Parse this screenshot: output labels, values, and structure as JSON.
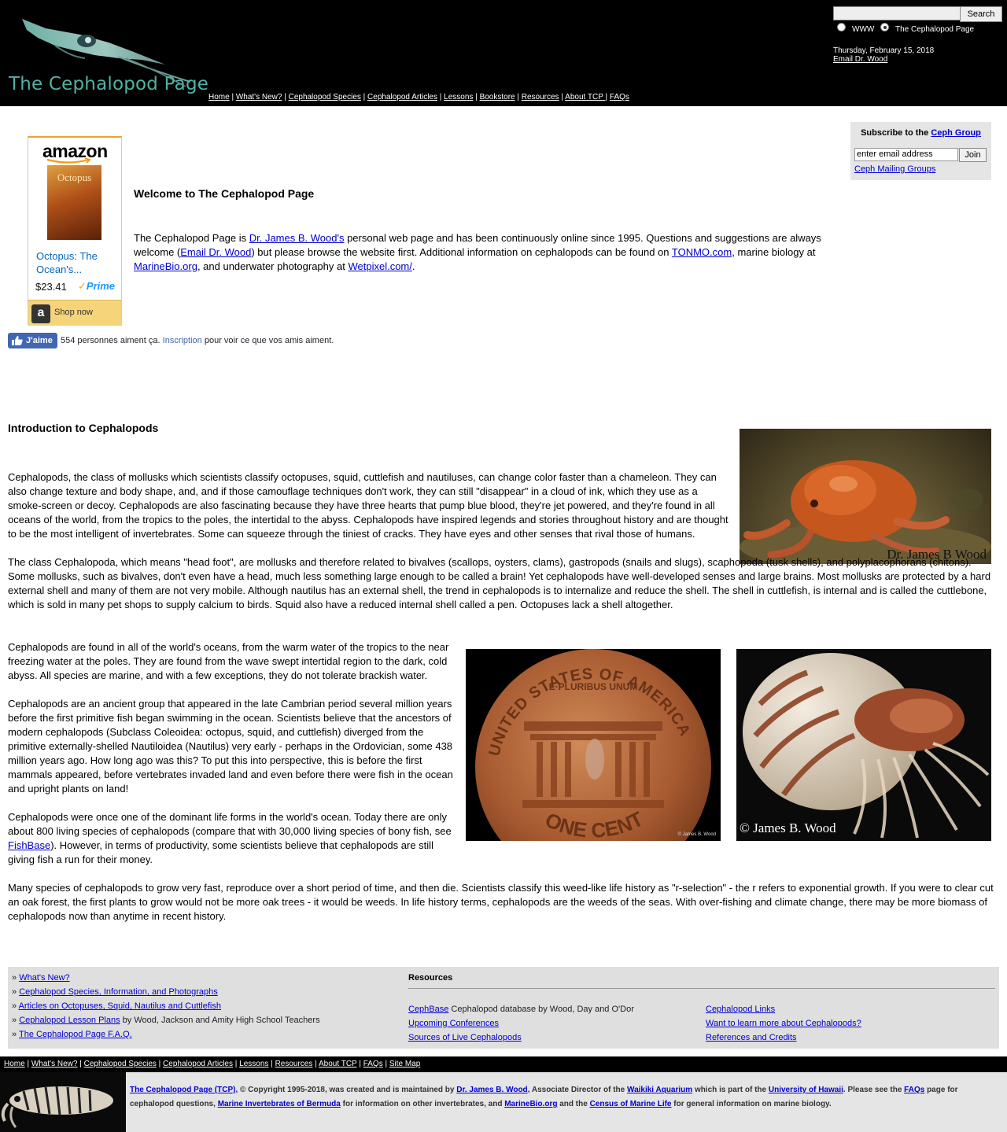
{
  "header": {
    "logo_title": "The Cephalopod Page",
    "nav": [
      "Home",
      "What's New?",
      "Cephalopod Species",
      "Cephalopod Articles",
      "Lessons",
      "Bookstore",
      "Resources",
      "About TCP ",
      "FAQs"
    ],
    "search_button": "Search",
    "radio_www": "WWW",
    "radio_site": "The Cephalopod Page",
    "selected_radio": "The Cephalopod Page",
    "date": "Thursday, February 15, 2018",
    "email_link": "Email Dr. Wood"
  },
  "amazon": {
    "logo": "amazon",
    "book_cover_title": "Octopus",
    "title": "Octopus: The Ocean's...",
    "price": "$23.41",
    "prime": "Prime",
    "shop_now": "Shop now"
  },
  "welcome": {
    "heading": "Welcome to The Cephalopod Page",
    "t1": "The Cephalopod Page is ",
    "link_wood": "Dr. James B. Wood's",
    "t2": " personal web page and has been continuously online since 1995. Questions and suggestions are always welcome (",
    "link_email": "Email Dr. Wood",
    "t3": ") but please browse the website first. Additional information on cephalopods can be found on ",
    "link_tonmo": "TONMO.com",
    "t4": ", marine biology at ",
    "link_marinebio": "MarineBio.org",
    "t5": ", and underwater photography at ",
    "link_wetpixel": "Wetpixel.com/",
    "t6": "."
  },
  "subscribe": {
    "title_prefix": "Subscribe to the ",
    "title_link": "Ceph Group",
    "input_value": "enter email address",
    "join": "Join",
    "mailing_link": "Ceph Mailing Groups"
  },
  "facebook": {
    "like": "J'aime",
    "text": "554 personnes aiment ça. ",
    "signup": "Inscription",
    "text2": " pour voir ce que vos amis aiment."
  },
  "intro": {
    "heading": "Introduction to Cephalopods",
    "p1": "Cephalopods, the class of mollusks which scientists classify octopuses, squid, cuttlefish and nautiluses, can change color faster than a chameleon. They can also change texture and body shape, and, and if those camouflage techniques don't work, they can still \"disappear\" in a cloud of ink, which they use as a smoke-screen or decoy. Cephalopods are also fascinating because they have three hearts that pump blue blood, they're jet powered, and they're found in all oceans of the world, from the tropics to the poles, the intertidal to the abyss. Cephalopods have inspired legends and stories throughout history and are thought to be the most intelligent of invertebrates. Some can squeeze through the tiniest of cracks. They have eyes and other senses that rival those of humans.",
    "p2": "The class Cephalopoda, which means \"head foot\", are mollusks and therefore related to bivalves (scallops, oysters, clams), gastropods (snails and slugs), scaphopoda (tusk shells), and polyplacophorans (chitons). Some mollusks, such as bivalves, don't even have a head, much less something large enough to be called a brain! Yet cephalopods have well-developed senses and large brains. Most mollusks are protected by a hard external shell and many of them are not very mobile. Although nautilus has an external shell, the trend in cephalopods is to internalize and reduce the shell. The shell in cuttlefish, is internal and is called the cuttlebone, which is sold in many pet shops to supply calcium to birds. Squid also have a reduced internal shell called a pen. Octopuses lack a shell altogether.",
    "p3": "Cephalopods are found in all of the world's oceans, from the warm water of the tropics to the near freezing water at the poles. They are found from the wave swept intertidal region to the dark, cold abyss. All species are marine, and with a few exceptions, they do not tolerate brackish water.",
    "p4": "Cephalopods are an ancient group that appeared in the late Cambrian period several million years before the first primitive fish began swimming in the ocean. Scientists believe that the ancestors of modern cephalopods (Subclass Coleoidea: octopus, squid, and cuttlefish) diverged from the primitive externally-shelled Nautiloidea (Nautilus) very early - perhaps in the Ordovician, some 438 million years ago. How long ago was this? To put this into perspective, this is before the first mammals appeared, before vertebrates invaded land and even before there were fish in the ocean and upright plants on land!",
    "p5a": "Cephalopods were once one of the dominant life forms in the world's ocean. Today there are only about 800 living species of cephalopods (compare that with 30,000 living species of bony fish, see ",
    "p5_link": "FishBase",
    "p5b": "). However, in terms of productivity, some scientists believe that cephalopods are still giving fish a run for their money.",
    "p6": "Many species of cephalopods to grow very fast, reproduce over a short period of time, and then die. Scientists classify this weed-like life history as \"r-selection\" - the r refers to exponential growth. If you were to clear cut an oak forest, the first plants to grow would not be more oak trees - it would be weeds. In life history terms, cephalopods are the weeds of the seas. With over-fishing and climate change, there may be more biomass of cephalopods now than anytime in recent history.",
    "photo_credit_octopus": "Dr. James B Wood",
    "photo_credit_nautilus": "© James B. Wood",
    "photo_credit_penny": "© James B. Wood",
    "penny_top_text": "UNITED STATES OF AMERICA",
    "penny_motto": "E·PLURIBUS UNUM",
    "penny_bottom_text": "ONE CENT"
  },
  "links": {
    "bullet": "» ",
    "items": [
      {
        "link": "What's New?",
        "rest": ""
      },
      {
        "link": "Cephalopod Species, Information, and Photographs",
        "rest": ""
      },
      {
        "link": "Articles on Octopuses, Squid, Nautilus and Cuttlefish",
        "rest": ""
      },
      {
        "link": "Cephalopod Lesson Plans",
        "rest": " by Wood, Jackson and Amity High School Teachers"
      },
      {
        "link": "The Cephalopod Page F.A.Q.",
        "rest": ""
      }
    ],
    "resources_title": "Resources",
    "resources": [
      {
        "link": "CephBase",
        "rest": " Cephalopod database by Wood, Day and O'Dor"
      },
      {
        "link": "Upcoming Conferences",
        "rest": ""
      },
      {
        "link": "Sources of Live Cephalopods",
        "rest": ""
      },
      {
        "link": "Cephalopod Links",
        "rest": ""
      },
      {
        "link": "Want to learn more about Cephalopods?",
        "rest": ""
      },
      {
        "link": "References and Credits",
        "rest": ""
      }
    ]
  },
  "footer": {
    "nav": [
      "Home",
      "What's New?",
      "Cephalopod Species",
      "Cephalopod Articles",
      "Lessons",
      "Resources",
      "About TCP",
      "FAQs",
      "Site Map"
    ],
    "l_tcp": "The Cephalopod Page (TCP)",
    "t1": ", © Copyright 1995-2018, was created and is maintained by ",
    "l_wood": "Dr. James B. Wood",
    "t2": ", Associate Director of the ",
    "l_waikiki": "Waikiki Aquarium",
    "t3": " which is part of the ",
    "l_hawaii": "University of Hawaii",
    "t4": ". Please see the ",
    "l_faqs": "FAQs",
    "t5": " page for cephalopod questions, ",
    "l_bermuda": "Marine Invertebrates of Bermuda",
    "t6": " for information on other invertebrates, and ",
    "l_marinebio": "MarineBio.org",
    "t7": " and the ",
    "l_census": "Census of Marine Life",
    "t8": " for general information on marine biology."
  }
}
